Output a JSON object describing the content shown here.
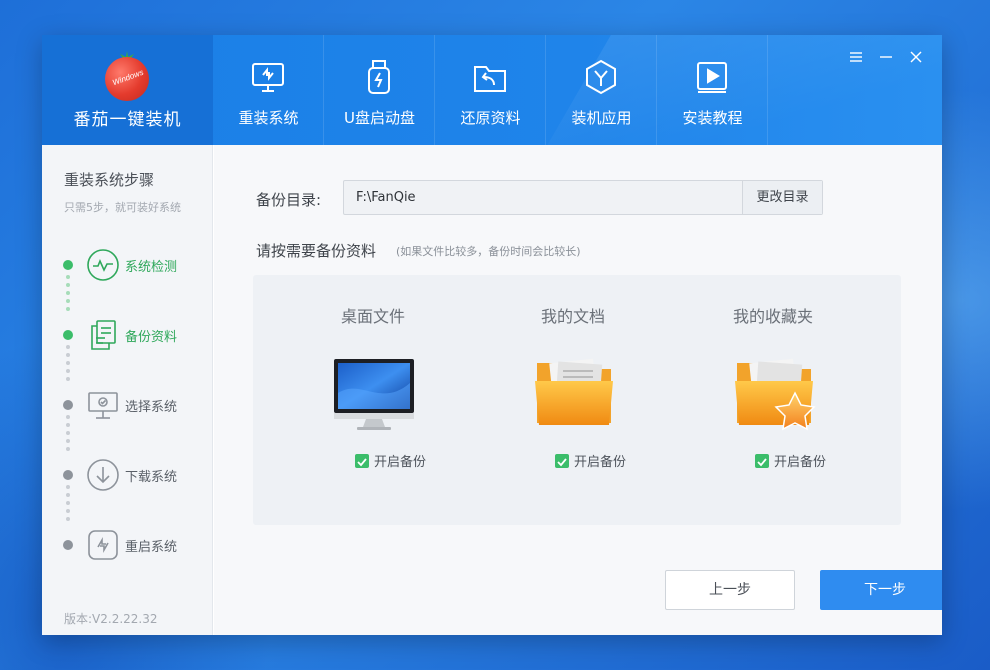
{
  "app": {
    "brand_name": "番茄一键装机",
    "logo_text": "Windows"
  },
  "nav": [
    {
      "label": "重装系统",
      "icon": "reinstall-monitor-icon"
    },
    {
      "label": "U盘启动盘",
      "icon": "usb-drive-icon"
    },
    {
      "label": "还原资料",
      "icon": "restore-folder-icon"
    },
    {
      "label": "装机应用",
      "icon": "apps-y-icon"
    },
    {
      "label": "安装教程",
      "icon": "tutorial-play-icon"
    }
  ],
  "sidebar": {
    "title": "重装系统步骤",
    "subtitle": "只需5步，就可装好系统",
    "steps": [
      {
        "label": "系统检测",
        "icon": "pulse-monitor-icon",
        "status": "done"
      },
      {
        "label": "备份资料",
        "icon": "documents-copy-icon",
        "status": "done"
      },
      {
        "label": "选择系统",
        "icon": "select-system-monitor-icon",
        "status": "pending"
      },
      {
        "label": "下载系统",
        "icon": "download-arrow-icon",
        "status": "pending"
      },
      {
        "label": "重启系统",
        "icon": "restart-arrows-icon",
        "status": "pending"
      }
    ],
    "version": "版本:V2.2.22.32"
  },
  "main": {
    "backup_dir_label": "备份目录:",
    "backup_dir_value": "F:\\FanQie",
    "change_dir_button": "更改目录",
    "section_title": "请按需要备份资料",
    "section_note": "(如果文件比较多，备份时间会比较长)",
    "items": [
      {
        "title": "桌面文件",
        "checkbox_label": "开启备份",
        "checked": true,
        "icon": "desktop-computer-icon"
      },
      {
        "title": "我的文档",
        "checkbox_label": "开启备份",
        "checked": true,
        "icon": "documents-folder-icon"
      },
      {
        "title": "我的收藏夹",
        "checkbox_label": "开启备份",
        "checked": true,
        "icon": "favorites-folder-star-icon"
      }
    ],
    "prev_button": "上一步",
    "next_button": "下一步"
  },
  "colors": {
    "header_blue": "#1f84ea",
    "accent_green": "#3bbd6a",
    "primary_button": "#2f8cf0"
  }
}
